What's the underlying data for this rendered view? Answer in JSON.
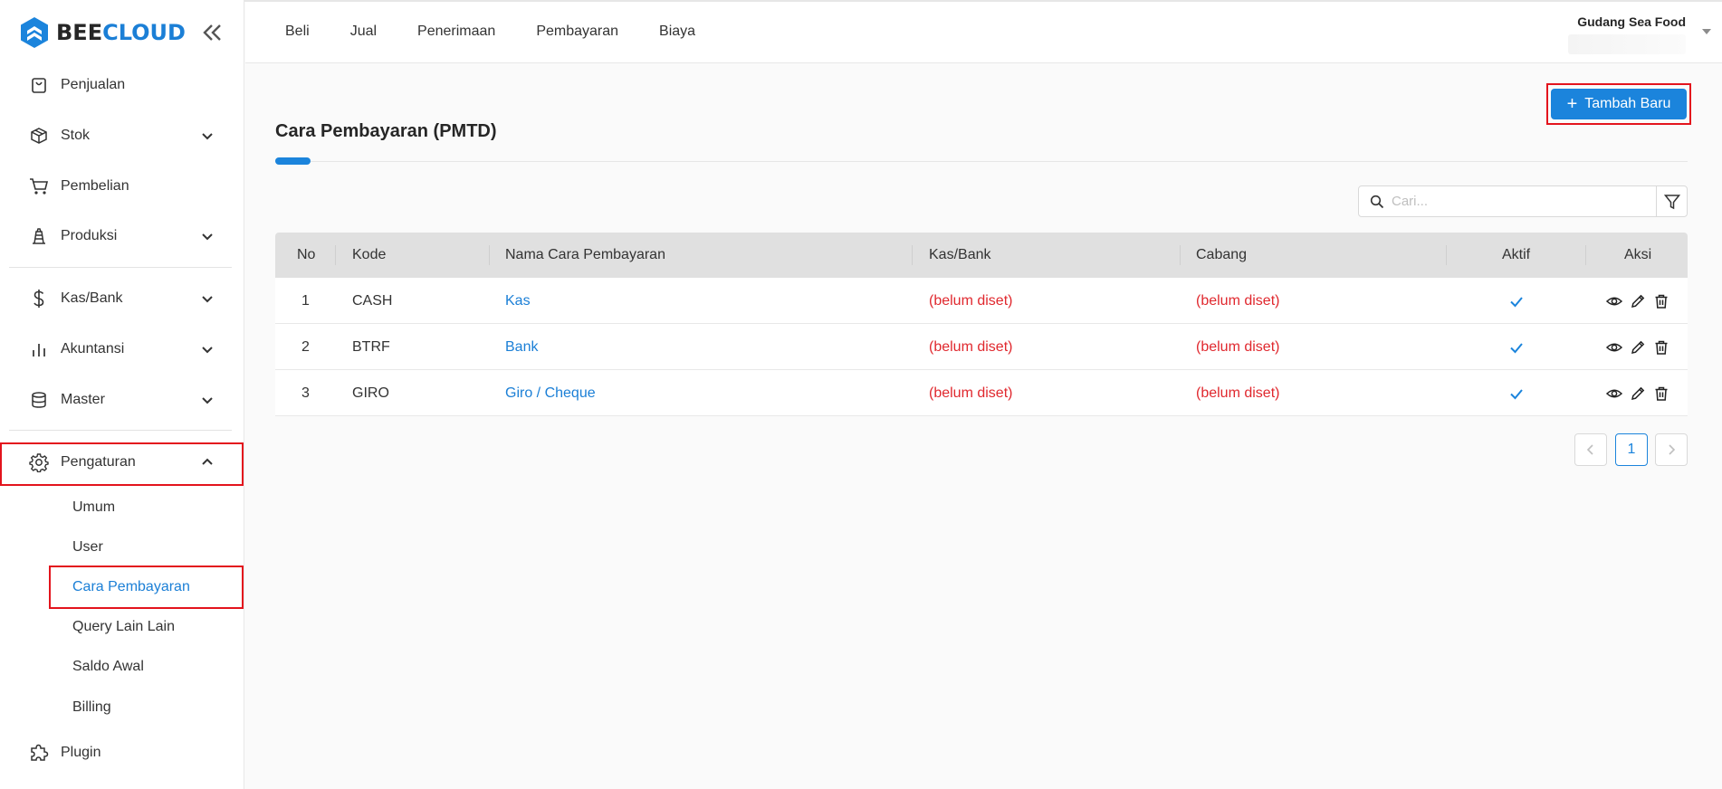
{
  "brand": {
    "part1": "BEE",
    "part2": "CLOUD",
    "primary": "#1b84dc",
    "danger": "#e3141d"
  },
  "sidebar": {
    "items": [
      {
        "label": "Penjualan",
        "icon": "shopping-bag-icon"
      },
      {
        "label": "Stok",
        "icon": "box-icon"
      },
      {
        "label": "Pembelian",
        "icon": "cart-icon"
      },
      {
        "label": "Produksi",
        "icon": "factory-icon"
      },
      {
        "label": "Kas/Bank",
        "icon": "dollar-icon"
      },
      {
        "label": "Akuntansi",
        "icon": "bar-chart-icon"
      },
      {
        "label": "Master",
        "icon": "database-icon"
      },
      {
        "label": "Pengaturan",
        "icon": "gear-icon"
      },
      {
        "label": "Plugin",
        "icon": "puzzle-icon"
      }
    ],
    "sub_items": [
      {
        "label": "Umum"
      },
      {
        "label": "User"
      },
      {
        "label": "Cara Pembayaran"
      },
      {
        "label": "Query Lain Lain"
      },
      {
        "label": "Saldo Awal"
      },
      {
        "label": "Billing"
      }
    ],
    "active_sub": "Cara Pembayaran"
  },
  "topnav": {
    "items": [
      "Beli",
      "Jual",
      "Penerimaan",
      "Pembayaran",
      "Biaya"
    ]
  },
  "company": {
    "name": "Gudang Sea Food"
  },
  "main": {
    "add_button": "Tambah Baru",
    "title": "Cara Pembayaran (PMTD)",
    "search_placeholder": "Cari...",
    "columns": [
      "No",
      "Kode",
      "Nama Cara Pembayaran",
      "Kas/Bank",
      "Cabang",
      "Aktif",
      "Aksi"
    ],
    "rows": [
      {
        "no": "1",
        "kode": "CASH",
        "nama": "Kas",
        "kas_bank": "(belum diset)",
        "cabang": "(belum diset)",
        "aktif": true
      },
      {
        "no": "2",
        "kode": "BTRF",
        "nama": "Bank",
        "kas_bank": "(belum diset)",
        "cabang": "(belum diset)",
        "aktif": true
      },
      {
        "no": "3",
        "kode": "GIRO",
        "nama": "Giro / Cheque",
        "kas_bank": "(belum diset)",
        "cabang": "(belum diset)",
        "aktif": true
      }
    ],
    "pagination": {
      "current": "1"
    }
  }
}
